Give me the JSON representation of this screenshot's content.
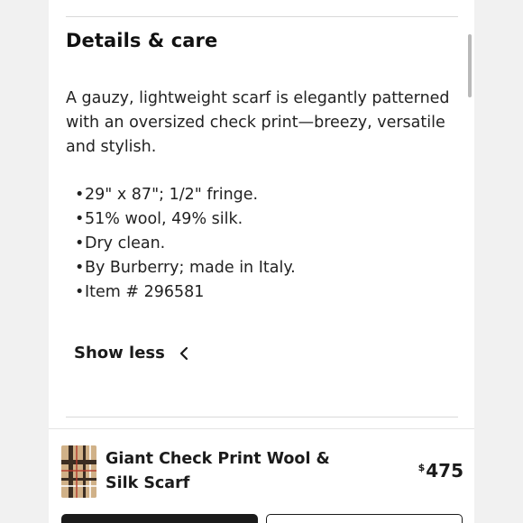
{
  "details": {
    "heading": "Details & care",
    "description": "A gauzy, lightweight scarf is elegantly patterned with an oversized check print—breezy, versatile and stylish.",
    "bullets": [
      "29\" x 87\"; 1/2\" fringe.",
      "51% wool, 49% silk.",
      "Dry clean.",
      "By Burberry; made in Italy.",
      "Item # 296581"
    ],
    "show_less_label": "Show less",
    "show_less_icon": "chevron-left-icon"
  },
  "product_bar": {
    "name": "Giant Check Print Wool & Silk Scarf",
    "price_currency": "$",
    "price_value": "475",
    "thumbnail_icon": "product-thumbnail"
  },
  "colors": {
    "text": "#1b1b1b",
    "divider": "#d9d9d9",
    "background": "#f1f1f1",
    "thumb_tan": "#c9a77c",
    "thumb_stripe": "#3b2d22"
  }
}
